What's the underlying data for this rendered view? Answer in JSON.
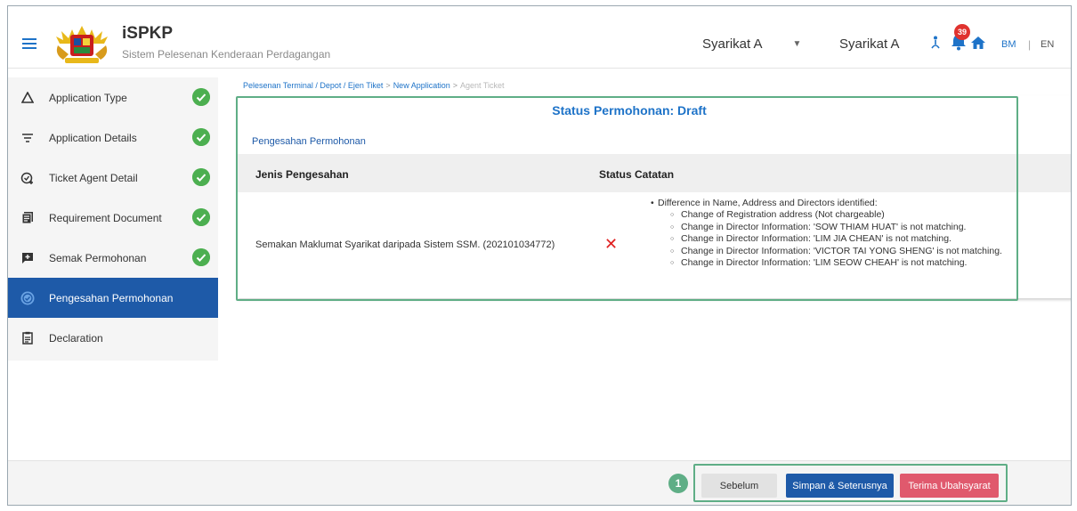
{
  "header": {
    "app_title": "iSPKP",
    "app_subtitle": "Sistem Pelesenan Kenderaan Perdagangan",
    "company_select_value": "Syarikat A",
    "company_name": "Syarikat A",
    "notification_count": "39",
    "lang_bm": "BM",
    "lang_sep": "|",
    "lang_en": "EN"
  },
  "sidebar": {
    "items": [
      {
        "label": "Application Type",
        "icon": "triangle-icon",
        "completed": true
      },
      {
        "label": "Application Details",
        "icon": "filter-lines-icon",
        "completed": true
      },
      {
        "label": "Ticket Agent Detail",
        "icon": "person-add-icon",
        "completed": true
      },
      {
        "label": "Requirement Document",
        "icon": "document-icon",
        "completed": true
      },
      {
        "label": "Semak Permohonan",
        "icon": "message-add-icon",
        "completed": true
      },
      {
        "label": "Pengesahan Permohonan",
        "icon": "check-circle-icon",
        "completed": false,
        "active": true
      },
      {
        "label": "Declaration",
        "icon": "clipboard-icon",
        "completed": false
      }
    ]
  },
  "breadcrumb": {
    "items": [
      "Pelesenan Terminal / Depot / Ejen Tiket",
      "New Application",
      "Agent Ticket"
    ],
    "separator": ">"
  },
  "panel": {
    "title": "Status Permohonan: Draft",
    "section_title": "Pengesahan Permohonan",
    "columns": [
      "Jenis Pengesahan",
      "Status Catatan"
    ],
    "row": {
      "verification": "Semakan Maklumat Syarikat daripada Sistem SSM. (202101034772)",
      "status_mark": "✕",
      "note_heading": "Difference in Name, Address and Directors identified:",
      "note_items": [
        "Change of Registration address (Not chargeable)",
        "Change in Director Information: 'SOW THIAM HUAT' is not matching.",
        "Change in Director Information: 'LIM JIA CHEAN' is not matching.",
        "Change in Director Information: 'VICTOR TAI YONG SHENG' is not matching.",
        "Change in Director Information: 'LIM SEOW CHEAH' is not matching."
      ]
    }
  },
  "footer": {
    "step_number": "1",
    "prev_label": "Sebelum",
    "save_next_label": "Simpan & Seterusnya",
    "accept_label": "Terima Ubahsyarat"
  },
  "colors": {
    "primary": "#1e73c8",
    "active_nav": "#1e5aa8",
    "success": "#4caf50",
    "danger": "#e02020",
    "annotation": "#5fae86",
    "accept_button": "#e0596d"
  }
}
